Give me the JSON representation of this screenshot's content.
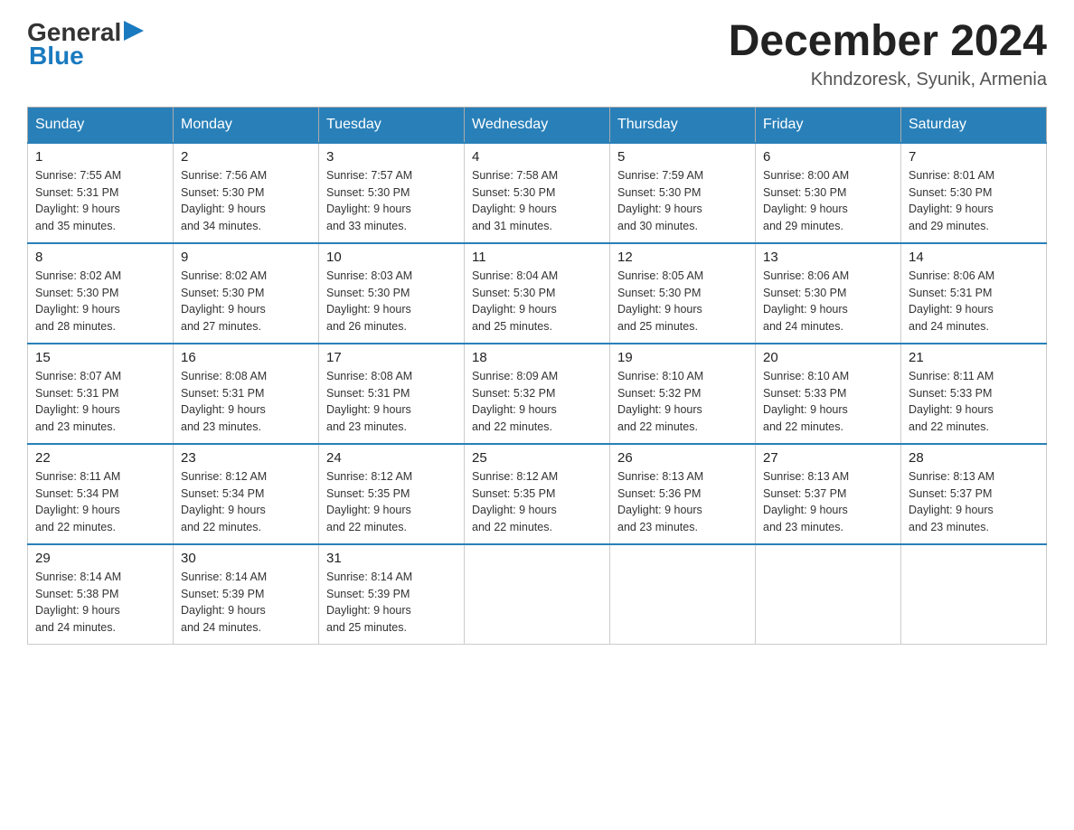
{
  "logo": {
    "general": "General",
    "arrow": "▶",
    "blue": "Blue"
  },
  "header": {
    "month": "December 2024",
    "location": "Khndzoresk, Syunik, Armenia"
  },
  "days_of_week": [
    "Sunday",
    "Monday",
    "Tuesday",
    "Wednesday",
    "Thursday",
    "Friday",
    "Saturday"
  ],
  "weeks": [
    [
      {
        "day": "1",
        "sunrise": "7:55 AM",
        "sunset": "5:31 PM",
        "daylight": "9 hours and 35 minutes."
      },
      {
        "day": "2",
        "sunrise": "7:56 AM",
        "sunset": "5:30 PM",
        "daylight": "9 hours and 34 minutes."
      },
      {
        "day": "3",
        "sunrise": "7:57 AM",
        "sunset": "5:30 PM",
        "daylight": "9 hours and 33 minutes."
      },
      {
        "day": "4",
        "sunrise": "7:58 AM",
        "sunset": "5:30 PM",
        "daylight": "9 hours and 31 minutes."
      },
      {
        "day": "5",
        "sunrise": "7:59 AM",
        "sunset": "5:30 PM",
        "daylight": "9 hours and 30 minutes."
      },
      {
        "day": "6",
        "sunrise": "8:00 AM",
        "sunset": "5:30 PM",
        "daylight": "9 hours and 29 minutes."
      },
      {
        "day": "7",
        "sunrise": "8:01 AM",
        "sunset": "5:30 PM",
        "daylight": "9 hours and 29 minutes."
      }
    ],
    [
      {
        "day": "8",
        "sunrise": "8:02 AM",
        "sunset": "5:30 PM",
        "daylight": "9 hours and 28 minutes."
      },
      {
        "day": "9",
        "sunrise": "8:02 AM",
        "sunset": "5:30 PM",
        "daylight": "9 hours and 27 minutes."
      },
      {
        "day": "10",
        "sunrise": "8:03 AM",
        "sunset": "5:30 PM",
        "daylight": "9 hours and 26 minutes."
      },
      {
        "day": "11",
        "sunrise": "8:04 AM",
        "sunset": "5:30 PM",
        "daylight": "9 hours and 25 minutes."
      },
      {
        "day": "12",
        "sunrise": "8:05 AM",
        "sunset": "5:30 PM",
        "daylight": "9 hours and 25 minutes."
      },
      {
        "day": "13",
        "sunrise": "8:06 AM",
        "sunset": "5:30 PM",
        "daylight": "9 hours and 24 minutes."
      },
      {
        "day": "14",
        "sunrise": "8:06 AM",
        "sunset": "5:31 PM",
        "daylight": "9 hours and 24 minutes."
      }
    ],
    [
      {
        "day": "15",
        "sunrise": "8:07 AM",
        "sunset": "5:31 PM",
        "daylight": "9 hours and 23 minutes."
      },
      {
        "day": "16",
        "sunrise": "8:08 AM",
        "sunset": "5:31 PM",
        "daylight": "9 hours and 23 minutes."
      },
      {
        "day": "17",
        "sunrise": "8:08 AM",
        "sunset": "5:31 PM",
        "daylight": "9 hours and 23 minutes."
      },
      {
        "day": "18",
        "sunrise": "8:09 AM",
        "sunset": "5:32 PM",
        "daylight": "9 hours and 22 minutes."
      },
      {
        "day": "19",
        "sunrise": "8:10 AM",
        "sunset": "5:32 PM",
        "daylight": "9 hours and 22 minutes."
      },
      {
        "day": "20",
        "sunrise": "8:10 AM",
        "sunset": "5:33 PM",
        "daylight": "9 hours and 22 minutes."
      },
      {
        "day": "21",
        "sunrise": "8:11 AM",
        "sunset": "5:33 PM",
        "daylight": "9 hours and 22 minutes."
      }
    ],
    [
      {
        "day": "22",
        "sunrise": "8:11 AM",
        "sunset": "5:34 PM",
        "daylight": "9 hours and 22 minutes."
      },
      {
        "day": "23",
        "sunrise": "8:12 AM",
        "sunset": "5:34 PM",
        "daylight": "9 hours and 22 minutes."
      },
      {
        "day": "24",
        "sunrise": "8:12 AM",
        "sunset": "5:35 PM",
        "daylight": "9 hours and 22 minutes."
      },
      {
        "day": "25",
        "sunrise": "8:12 AM",
        "sunset": "5:35 PM",
        "daylight": "9 hours and 22 minutes."
      },
      {
        "day": "26",
        "sunrise": "8:13 AM",
        "sunset": "5:36 PM",
        "daylight": "9 hours and 23 minutes."
      },
      {
        "day": "27",
        "sunrise": "8:13 AM",
        "sunset": "5:37 PM",
        "daylight": "9 hours and 23 minutes."
      },
      {
        "day": "28",
        "sunrise": "8:13 AM",
        "sunset": "5:37 PM",
        "daylight": "9 hours and 23 minutes."
      }
    ],
    [
      {
        "day": "29",
        "sunrise": "8:14 AM",
        "sunset": "5:38 PM",
        "daylight": "9 hours and 24 minutes."
      },
      {
        "day": "30",
        "sunrise": "8:14 AM",
        "sunset": "5:39 PM",
        "daylight": "9 hours and 24 minutes."
      },
      {
        "day": "31",
        "sunrise": "8:14 AM",
        "sunset": "5:39 PM",
        "daylight": "9 hours and 25 minutes."
      },
      null,
      null,
      null,
      null
    ]
  ],
  "labels": {
    "sunrise": "Sunrise:",
    "sunset": "Sunset:",
    "daylight": "Daylight:"
  }
}
